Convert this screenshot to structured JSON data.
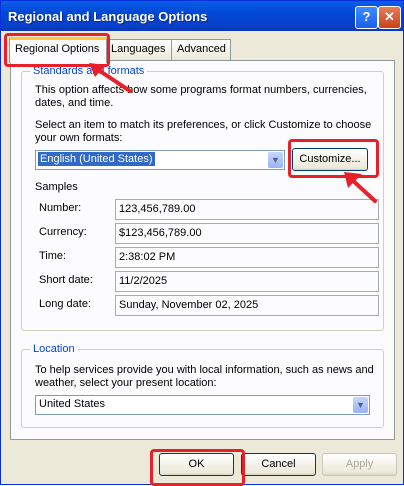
{
  "window": {
    "title": "Regional and Language Options"
  },
  "titlebar": {
    "help": "?",
    "close": "✕"
  },
  "tabs": [
    "Regional Options",
    "Languages",
    "Advanced"
  ],
  "standards": {
    "legend": "Standards and formats",
    "desc1": "This option affects how some programs format numbers, currencies,",
    "desc2": "dates, and time.",
    "select1": "Select an item to match its preferences, or click Customize to choose",
    "select2": "your own formats:",
    "format_value": "English (United States)",
    "customize_label": "Customize...",
    "samples_label": "Samples",
    "samples": [
      {
        "label": "Number:",
        "value": "123,456,789.00"
      },
      {
        "label": "Currency:",
        "value": "$123,456,789.00"
      },
      {
        "label": "Time:",
        "value": "2:38:02 PM"
      },
      {
        "label": "Short date:",
        "value": "11/2/2025"
      },
      {
        "label": "Long date:",
        "value": "Sunday, November 02, 2025"
      }
    ]
  },
  "location": {
    "legend": "Location",
    "desc1": "To help services provide you with local information, such as news and",
    "desc2": "weather, select your present location:",
    "value": "United States"
  },
  "buttons": {
    "ok": "OK",
    "cancel": "Cancel",
    "apply": "Apply"
  },
  "colors": {
    "highlight": "#e8202a",
    "title_bar": "#0047d6",
    "group_label": "#0046d5"
  }
}
